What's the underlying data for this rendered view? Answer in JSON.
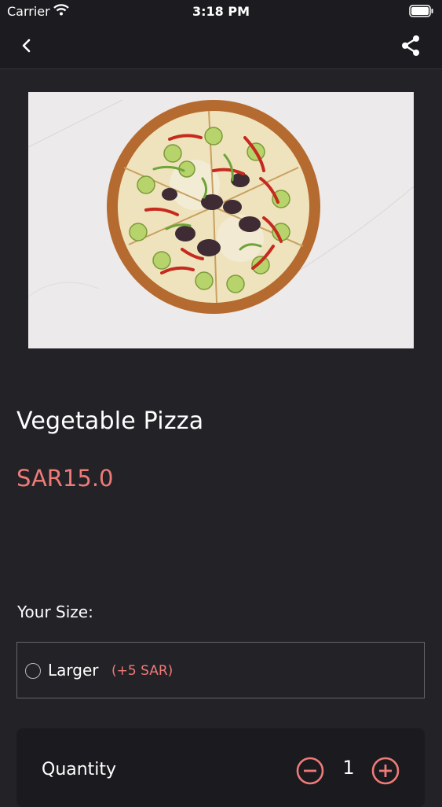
{
  "status_bar": {
    "carrier": "Carrier",
    "time": "3:18 PM"
  },
  "icons": {
    "back": "chevron-left-icon",
    "share": "share-icon",
    "minus": "minus-circle-icon",
    "plus": "plus-circle-icon",
    "wifi": "wifi-icon",
    "battery": "battery-icon"
  },
  "product": {
    "name": "Vegetable Pizza",
    "price": "SAR15.0"
  },
  "size_section": {
    "label": "Your Size:",
    "options": [
      {
        "label": "Larger",
        "extra": "(+5 SAR)",
        "selected": false
      }
    ]
  },
  "quantity": {
    "label": "Quantity",
    "value": "1"
  },
  "colors": {
    "accent": "#ee7b78",
    "background": "#232227",
    "bar": "#1c1b20"
  }
}
